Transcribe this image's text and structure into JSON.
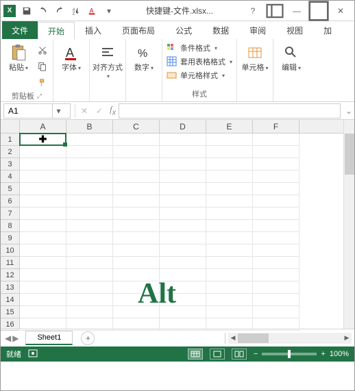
{
  "titlebar": {
    "app_initials": "X",
    "title": "快捷键-文件.xlsx..."
  },
  "menu": {
    "file": "文件",
    "tabs": [
      "开始",
      "插入",
      "页面布局",
      "公式",
      "数据",
      "审阅",
      "视图",
      "加"
    ]
  },
  "ribbon": {
    "clipboard": {
      "paste": "粘贴",
      "label": "剪贴板"
    },
    "font": {
      "btn": "字体",
      "label": "字体"
    },
    "align": {
      "btn": "对齐方式",
      "label": ""
    },
    "number": {
      "btn": "数字",
      "label": ""
    },
    "styles": {
      "cond": "条件格式",
      "table": "套用表格格式",
      "cell": "单元格样式",
      "label": "样式"
    },
    "cells": {
      "btn": "单元格"
    },
    "editing": {
      "btn": "编辑"
    }
  },
  "namebox": {
    "value": "A1"
  },
  "columns": [
    "A",
    "B",
    "C",
    "D",
    "E",
    "F"
  ],
  "rows": [
    "1",
    "2",
    "3",
    "4",
    "5",
    "6",
    "7",
    "8",
    "9",
    "10",
    "11",
    "12",
    "13",
    "14",
    "15",
    "16"
  ],
  "overlay": "Alt",
  "sheet": {
    "tab": "Sheet1"
  },
  "status": {
    "ready": "就绪",
    "zoom": "100%"
  }
}
